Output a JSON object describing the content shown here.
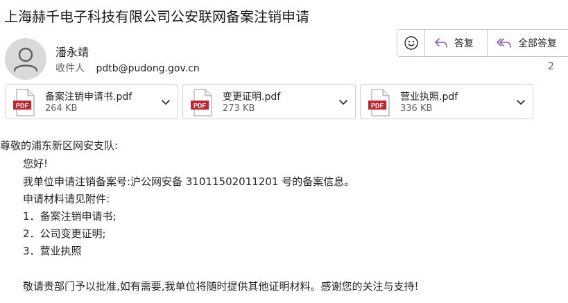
{
  "email": {
    "subject": "上海赫千电子科技有限公司公安联网备案注销申请",
    "sender_name": "潘永靖",
    "recipient_label": "收件人",
    "recipient_value": "pdtb@pudong.gov.cn",
    "date_fragment": "2"
  },
  "actions": {
    "emoji_icon": "smiley-icon",
    "reply_label": "答复",
    "reply_all_label": "全部答复"
  },
  "attachments": [
    {
      "name": "备案注销申请书.pdf",
      "size": "264 KB",
      "badge": "PDF"
    },
    {
      "name": "变更证明.pdf",
      "size": "273 KB",
      "badge": "PDF"
    },
    {
      "name": "营业执照.pdf",
      "size": "336 KB",
      "badge": "PDF"
    }
  ],
  "colors": {
    "accent_purple": "#8a5db3",
    "pdf_red": "#c4262e"
  },
  "body": {
    "greeting": "尊敬的浦东新区网安支队:",
    "line1": "您好!",
    "line2": "我单位申请注销备案号:沪公网安备 31011502011201 号的备案信息。",
    "line3": "申请材料请见附件:",
    "item1": "1．备案注销申请书;",
    "item2": "2．公司变更证明;",
    "item3": "3．营业执照",
    "closing": "敬请贵部门予以批准,如有需要,我单位将随时提供其他证明材料。感谢您的关注与支持!"
  }
}
